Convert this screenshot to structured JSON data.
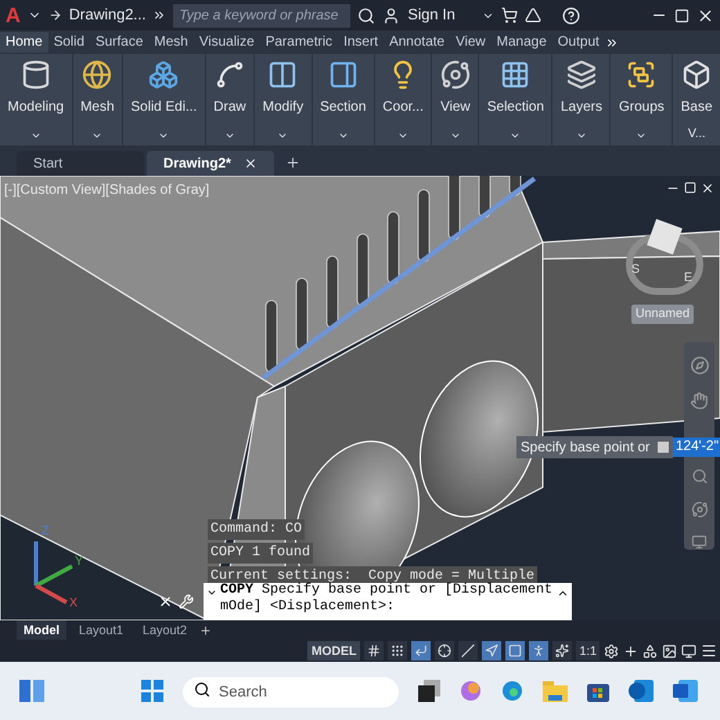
{
  "title_bar": {
    "logo": "A",
    "document": "Drawing2...",
    "search": {
      "placeholder": "Type a keyword or phrase"
    },
    "sign_in": "Sign In"
  },
  "ribbon_tabs": [
    {
      "label": "Home",
      "selected": true
    },
    {
      "label": "Solid",
      "selected": false
    },
    {
      "label": "Surface",
      "selected": false
    },
    {
      "label": "Mesh",
      "selected": false
    },
    {
      "label": "Visualize",
      "selected": false
    },
    {
      "label": "Parametric",
      "selected": false
    },
    {
      "label": "Insert",
      "selected": false
    },
    {
      "label": "Annotate",
      "selected": false
    },
    {
      "label": "View",
      "selected": false
    },
    {
      "label": "Manage",
      "selected": false
    },
    {
      "label": "Output",
      "selected": false
    }
  ],
  "ribbon_panels": [
    {
      "label": "Modeling"
    },
    {
      "label": "Mesh"
    },
    {
      "label": "Solid Edi..."
    },
    {
      "label": "Draw"
    },
    {
      "label": "Modify"
    },
    {
      "label": "Section"
    },
    {
      "label": "Coor..."
    },
    {
      "label": "View"
    },
    {
      "label": "Selection"
    },
    {
      "label": "Layers"
    },
    {
      "label": "Groups"
    },
    {
      "label": "Base",
      "footer": "V..."
    }
  ],
  "file_tabs": [
    {
      "label": "Start",
      "selected": false
    },
    {
      "label": "Drawing2*",
      "selected": true
    }
  ],
  "viewport": {
    "label": "[-][Custom View][Shades of Gray]",
    "compass": [
      "S",
      "E"
    ],
    "view_dropdown": "Unnamed",
    "tooltip": "Specify base point or",
    "input_value": "124'-2\"",
    "ucs_axes": [
      "Z",
      "Y",
      "X"
    ]
  },
  "command_history": [
    "Command: CO",
    "COPY 1 found",
    "Current settings:  Copy mode = Multiple"
  ],
  "command_line": "**COPY** Specify base point or [Displacement mOde] <Displacement>:",
  "layout_tabs": [
    {
      "label": "Model",
      "selected": true
    },
    {
      "label": "Layout1",
      "selected": false
    },
    {
      "label": "Layout2",
      "selected": false
    }
  ],
  "status_bar": {
    "mode": "MODEL",
    "scale": "1:1"
  },
  "status_toggles": [
    {
      "kind": "grid",
      "on": false
    },
    {
      "kind": "snap",
      "on": false
    },
    {
      "kind": "ortho",
      "on": true
    },
    {
      "kind": "polar",
      "on": false
    },
    {
      "kind": "isodraft",
      "on": false
    },
    {
      "kind": "tracking",
      "on": true
    },
    {
      "kind": "osnap",
      "on": true
    },
    {
      "kind": "annovis",
      "on": true
    },
    {
      "kind": "autoscale",
      "on": false
    }
  ],
  "taskbar": {
    "search_placeholder": "Search"
  }
}
